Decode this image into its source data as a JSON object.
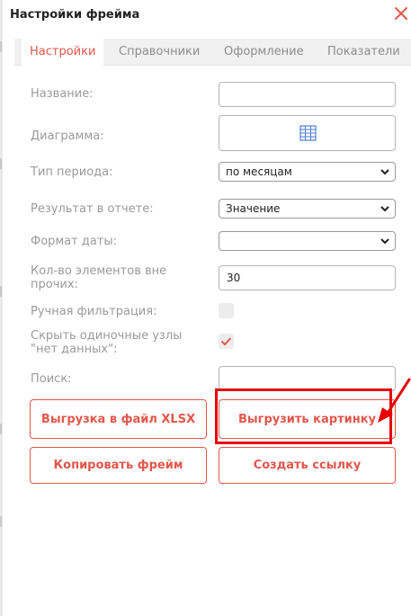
{
  "window": {
    "title": "Настройки фрейма",
    "close_icon": "close-icon"
  },
  "tabs": [
    {
      "label": "Настройки",
      "active": true
    },
    {
      "label": "Справочники",
      "active": false
    },
    {
      "label": "Оформление",
      "active": false
    },
    {
      "label": "Показатели",
      "active": false
    }
  ],
  "form": {
    "name": {
      "label": "Название:",
      "value": ""
    },
    "chart": {
      "label": "Диаграмма:",
      "icon": "table-grid-icon"
    },
    "period_type": {
      "label": "Тип периода:",
      "value": "по месяцам"
    },
    "report_result": {
      "label": "Результат в отчете:",
      "value": "Значение"
    },
    "date_format": {
      "label": "Формат даты:",
      "value": ""
    },
    "elements_outside": {
      "label": "Кол-во элементов вне прочих:",
      "value": "30"
    },
    "manual_filter": {
      "label": "Ручная фильтрация:",
      "checked": false
    },
    "hide_single_nodes": {
      "label": "Скрыть одиночные узлы \"нет данных\":",
      "checked": true
    },
    "search": {
      "label": "Поиск:",
      "value": ""
    }
  },
  "buttons": {
    "export_xlsx": "Выгрузка в файл XLSX",
    "export_image": "Выгрузить картинку",
    "copy_frame": "Копировать фрейм",
    "create_link": "Создать ссылку"
  },
  "colors": {
    "accent": "#e2574c",
    "highlight": "#e60000",
    "label": "#9a9a9a"
  }
}
